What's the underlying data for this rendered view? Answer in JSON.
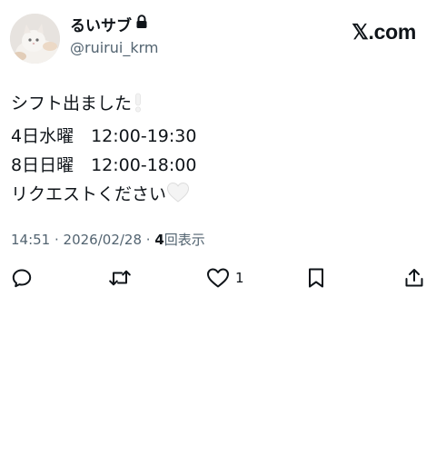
{
  "user": {
    "display_name": "るいサブ",
    "handle": "@ruirui_krm"
  },
  "brand": {
    "label": "𝕏.com"
  },
  "post": {
    "line1": "シフト出ました",
    "line2": "4日水曜　12:00-19:30",
    "line3": "8日日曜　12:00-18:00",
    "line4": "リクエストください"
  },
  "meta": {
    "time": "14:51",
    "separator": " · ",
    "date": "2026/02/28",
    "views_count": "4",
    "views_label": "回表示"
  },
  "actions": {
    "like_count": "1"
  },
  "icons": {
    "lock": "lock-icon",
    "exclamation": "white-exclamation-emoji",
    "heart_emoji": "white-heart-emoji",
    "reply": "reply-icon",
    "repost": "repost-icon",
    "like": "heart-icon",
    "bookmark": "bookmark-icon",
    "share": "share-icon"
  },
  "colors": {
    "text": "#0f1419",
    "secondary": "#536471",
    "background": "#ffffff"
  }
}
